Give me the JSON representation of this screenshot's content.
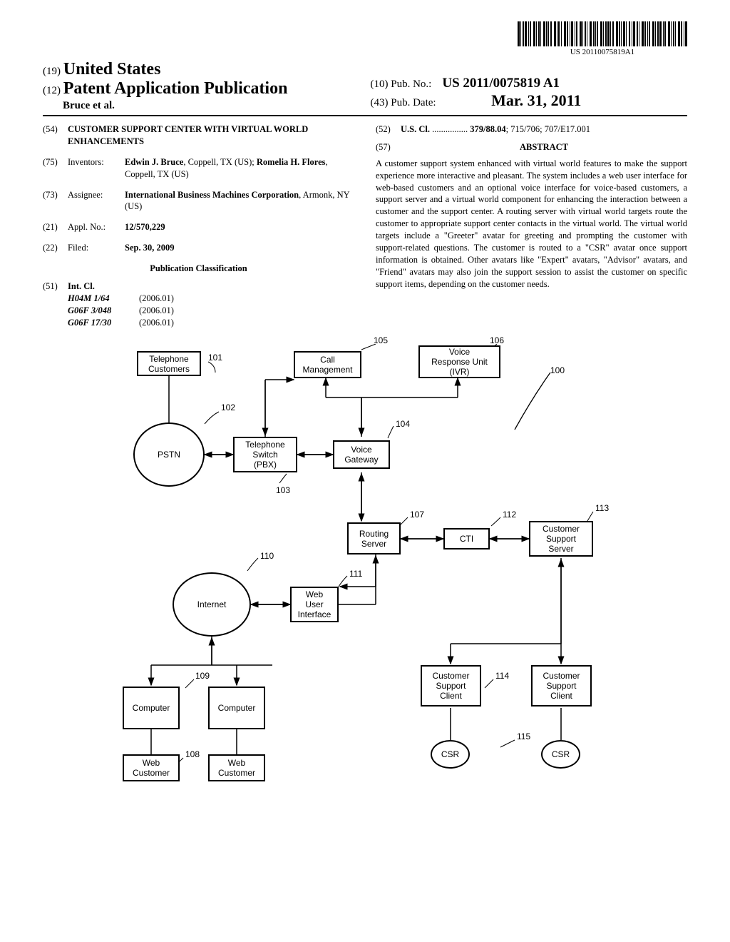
{
  "barcode_text": "US 20110075819A1",
  "header": {
    "code19": "(19)",
    "country": "United States",
    "code12": "(12)",
    "doc_type": "Patent Application Publication",
    "authors": "Bruce et al.",
    "code10": "(10)",
    "pub_no_label": "Pub. No.:",
    "pub_no": "US 2011/0075819 A1",
    "code43": "(43)",
    "pub_date_label": "Pub. Date:",
    "pub_date": "Mar. 31, 2011"
  },
  "fields": {
    "f54": {
      "code": "(54)",
      "title": "CUSTOMER SUPPORT CENTER WITH VIRTUAL WORLD ENHANCEMENTS"
    },
    "f75": {
      "code": "(75)",
      "label": "Inventors:",
      "value_bold1": "Edwin J. Bruce",
      "value_rest1": ", Coppell, TX (US);",
      "value_bold2": "Romelia H. Flores",
      "value_rest2": ", Coppell, TX (US)"
    },
    "f73": {
      "code": "(73)",
      "label": "Assignee:",
      "value_bold": "International Business Machines Corporation",
      "value_rest": ", Armonk, NY (US)"
    },
    "f21": {
      "code": "(21)",
      "label": "Appl. No.:",
      "value": "12/570,229"
    },
    "f22": {
      "code": "(22)",
      "label": "Filed:",
      "value": "Sep. 30, 2009"
    },
    "pub_class": "Publication Classification",
    "f51": {
      "code": "(51)",
      "label": "Int. Cl.",
      "rows": [
        {
          "cls": "H04M 1/64",
          "year": "(2006.01)"
        },
        {
          "cls": "G06F 3/048",
          "year": "(2006.01)"
        },
        {
          "cls": "G06F 17/30",
          "year": "(2006.01)"
        }
      ]
    },
    "f52": {
      "code": "(52)",
      "label": "U.S. Cl.",
      "dots": " ................ ",
      "value": "379/88.04",
      "value_rest": "; 715/706; 707/E17.001"
    },
    "f57": {
      "code": "(57)",
      "title": "ABSTRACT"
    },
    "abstract": "A customer support system enhanced with virtual world features to make the support experience more interactive and pleasant. The system includes a web user interface for web-based customers and an optional voice interface for voice-based customers, a support server and a virtual world component for enhancing the interaction between a customer and the support center. A routing server with virtual world targets route the customer to appropriate support center contacts in the virtual world. The virtual world targets include a \"Greeter\" avatar for greeting and prompting the customer with support-related questions. The customer is routed to a \"CSR\" avatar once support information is obtained. Other avatars like \"Expert\" avatars, \"Advisor\" avatars, and \"Friend\" avatars may also join the support session to assist the customer on specific support items, depending on the customer needs."
  },
  "diagram": {
    "telephone_customers": "Telephone\nCustomers",
    "call_management": "Call\nManagement",
    "ivr": "Voice\nResponse Unit\n(IVR)",
    "pstn": "PSTN",
    "pbx": "Telephone\nSwitch\n(PBX)",
    "voice_gateway": "Voice\nGateway",
    "routing_server": "Routing\nServer",
    "cti": "CTI",
    "css": "Customer\nSupport\nServer",
    "internet": "Internet",
    "wui": "Web\nUser\nInterface",
    "computer": "Computer",
    "web_customer": "Web\nCustomer",
    "csc": "Customer\nSupport\nClient",
    "csr": "CSR",
    "labels": {
      "100": "100",
      "101": "101",
      "102": "102",
      "103": "103",
      "104": "104",
      "105": "105",
      "106": "106",
      "107": "107",
      "108": "108",
      "109": "109",
      "110": "110",
      "111": "111",
      "112": "112",
      "113": "113",
      "114": "114",
      "115": "115"
    }
  }
}
